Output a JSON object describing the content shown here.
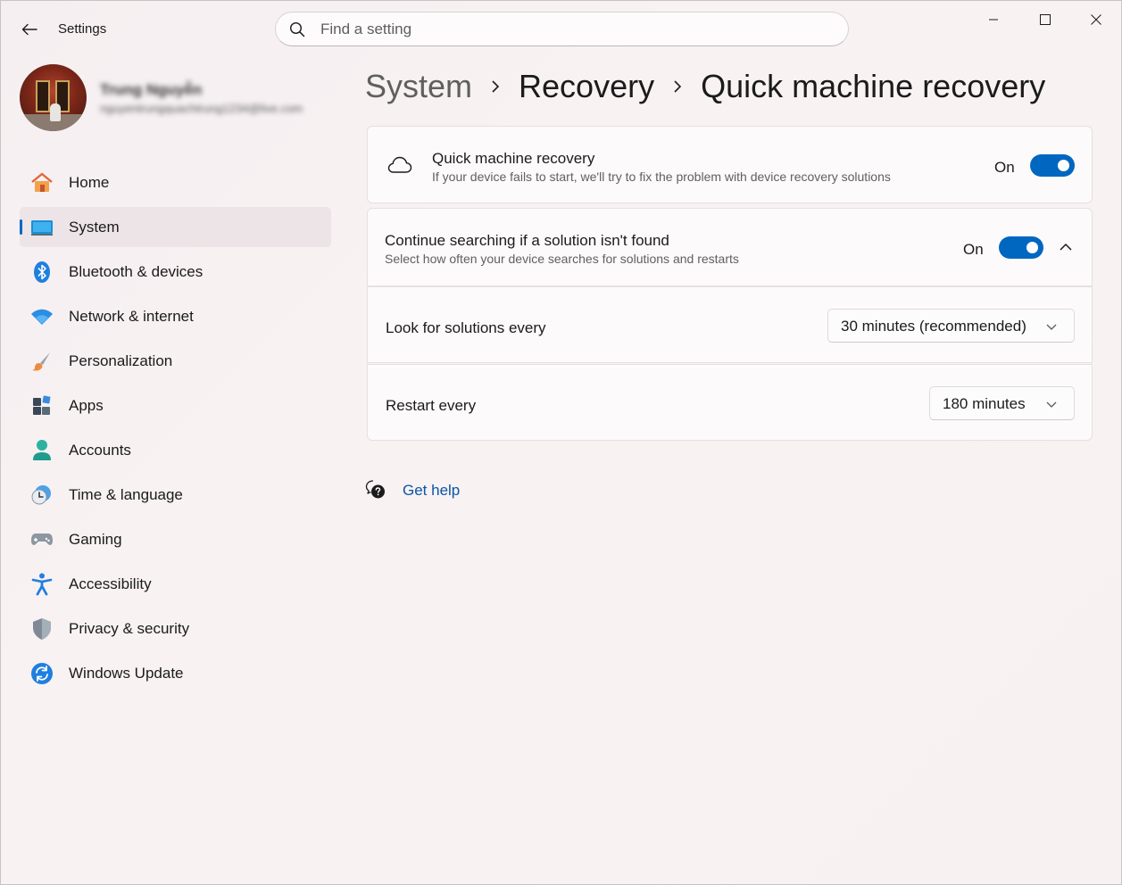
{
  "window": {
    "app_title": "Settings",
    "minimize_icon": "minimize-icon",
    "maximize_icon": "maximize-icon",
    "close_icon": "close-icon"
  },
  "search": {
    "placeholder": "Find a setting"
  },
  "profile": {
    "name": "Trung Nguyễn",
    "email": "nguyentrungquachtrung1234@live.com"
  },
  "sidebar": {
    "items": [
      {
        "label": "Home",
        "icon": "home-icon",
        "active": false
      },
      {
        "label": "System",
        "icon": "system-icon",
        "active": true
      },
      {
        "label": "Bluetooth & devices",
        "icon": "bluetooth-icon",
        "active": false
      },
      {
        "label": "Network & internet",
        "icon": "wifi-icon",
        "active": false
      },
      {
        "label": "Personalization",
        "icon": "brush-icon",
        "active": false
      },
      {
        "label": "Apps",
        "icon": "apps-icon",
        "active": false
      },
      {
        "label": "Accounts",
        "icon": "person-icon",
        "active": false
      },
      {
        "label": "Time & language",
        "icon": "clock-globe-icon",
        "active": false
      },
      {
        "label": "Gaming",
        "icon": "gamepad-icon",
        "active": false
      },
      {
        "label": "Accessibility",
        "icon": "accessibility-icon",
        "active": false
      },
      {
        "label": "Privacy & security",
        "icon": "shield-icon",
        "active": false
      },
      {
        "label": "Windows Update",
        "icon": "update-icon",
        "active": false
      }
    ]
  },
  "breadcrumb": {
    "items": [
      "System",
      "Recovery",
      "Quick machine recovery"
    ]
  },
  "settings": {
    "quick_recovery": {
      "title": "Quick machine recovery",
      "subtitle": "If your device fails to start, we'll try to fix the problem with device recovery solutions",
      "state_label": "On",
      "enabled": true,
      "icon": "cloud-icon"
    },
    "continue_searching": {
      "title": "Continue searching if a solution isn't found",
      "subtitle": "Select how often your device searches for solutions and restarts",
      "state_label": "On",
      "enabled": true,
      "expanded": true
    },
    "look_for_solutions": {
      "label": "Look for solutions every",
      "value": "30 minutes (recommended)"
    },
    "restart_every": {
      "label": "Restart every",
      "value": "180 minutes"
    }
  },
  "help": {
    "label": "Get help",
    "icon": "help-chat-icon"
  },
  "colors": {
    "accent": "#0067c0",
    "link": "#0a55a6",
    "background": "#f7f1f2"
  }
}
